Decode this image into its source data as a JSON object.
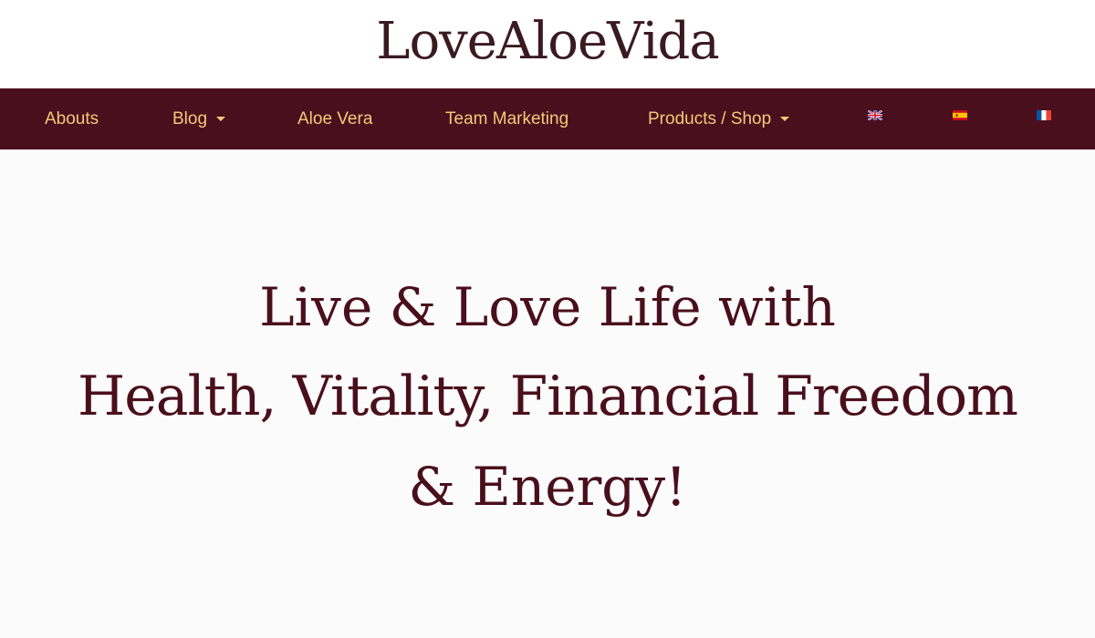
{
  "site": {
    "logo": "LoveAloeVida"
  },
  "nav": {
    "items": [
      {
        "label": "Abouts",
        "has_dropdown": false
      },
      {
        "label": "Blog",
        "has_dropdown": true
      },
      {
        "label": "Aloe Vera",
        "has_dropdown": false
      },
      {
        "label": "Team Marketing",
        "has_dropdown": false
      },
      {
        "label": "Products / Shop",
        "has_dropdown": true
      }
    ],
    "languages": [
      {
        "icon": "uk-flag-icon"
      },
      {
        "icon": "spain-flag-icon"
      },
      {
        "icon": "france-flag-icon"
      }
    ]
  },
  "hero": {
    "line1": "Live & Love Life with",
    "line2": "Health, Vitality, Financial Freedom",
    "line3": "& Energy!"
  },
  "colors": {
    "nav_background": "#4a0f1c",
    "nav_text": "#f3c97a",
    "hero_text": "#4a0f1c",
    "logo_text": "#3a1a20"
  }
}
